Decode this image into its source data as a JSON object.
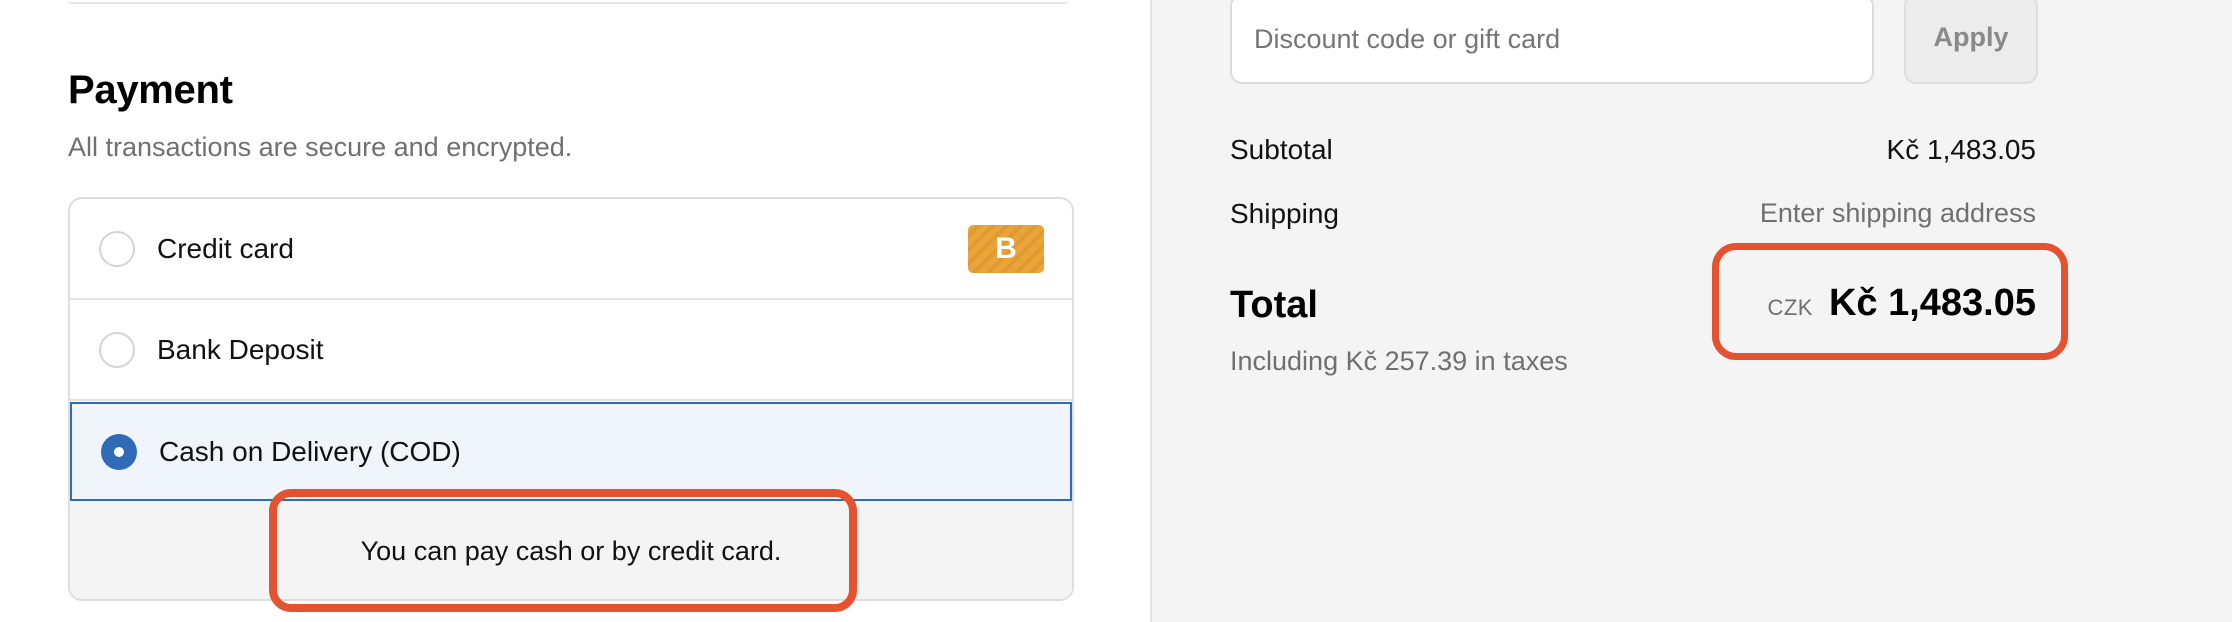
{
  "payment": {
    "title": "Payment",
    "subtitle": "All transactions are secure and encrypted.",
    "methods": [
      {
        "label": "Credit card",
        "selected": false,
        "badge": "B"
      },
      {
        "label": "Bank Deposit",
        "selected": false
      },
      {
        "label": "Cash on Delivery (COD)",
        "selected": true
      }
    ],
    "cod_info": "You can pay cash or by credit card."
  },
  "summary": {
    "discount_placeholder": "Discount code or gift card",
    "apply_label": "Apply",
    "subtotal_label": "Subtotal",
    "subtotal_value": "Kč 1,483.05",
    "shipping_label": "Shipping",
    "shipping_value": "Enter shipping address",
    "total_label": "Total",
    "currency_code": "CZK",
    "total_value": "Kč 1,483.05",
    "tax_note": "Including Kč 257.39 in taxes"
  },
  "colors": {
    "accent_blue": "#2f6bb7",
    "highlight_red": "#e5522f",
    "badge_orange": "#e9a43a"
  },
  "icons": {
    "card_badge": "credit-card-brand-icon",
    "radio_selected": "radio-checked-icon",
    "radio_unselected": "radio-unchecked-icon"
  }
}
